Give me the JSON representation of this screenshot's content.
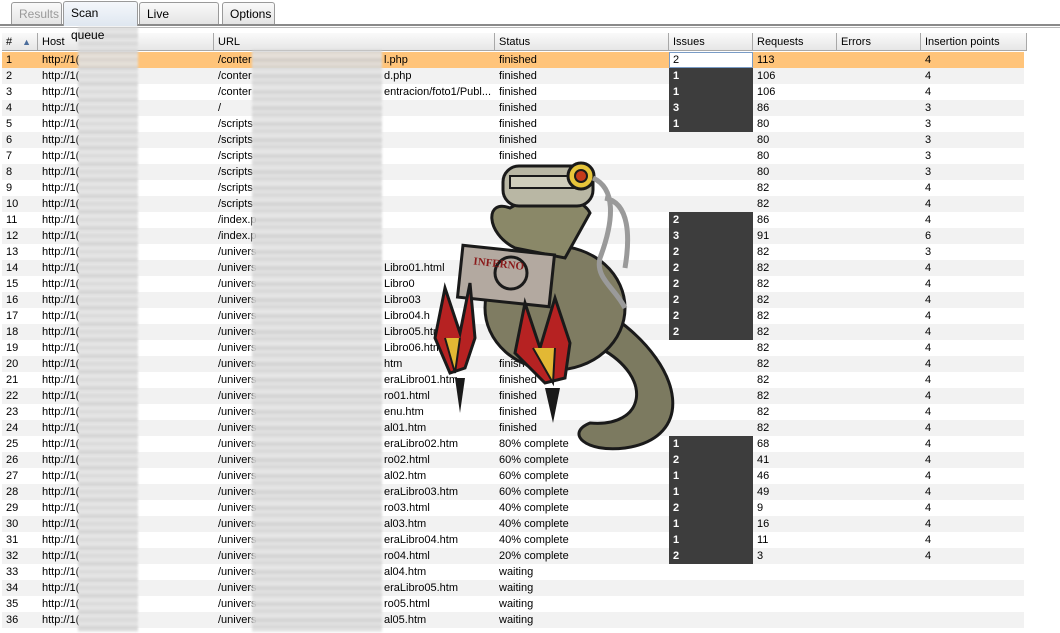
{
  "tabs": [
    {
      "label": "Results",
      "state": "disabled"
    },
    {
      "label": "Scan queue",
      "state": "active"
    },
    {
      "label": "Live scanning",
      "state": "normal"
    },
    {
      "label": "Options",
      "state": "normal"
    }
  ],
  "columns": [
    "#",
    "Host",
    "URL",
    "Status",
    "Issues",
    "Requests",
    "Errors",
    "Insertion points"
  ],
  "sort_column": "#",
  "sort_direction": "ascending",
  "rows": [
    {
      "num": "1",
      "host": "http://1(",
      "url": "/conter",
      "url_tail": "l.php",
      "status": "finished",
      "issues": "2",
      "requests": "113",
      "errors": "",
      "insertion": "4"
    },
    {
      "num": "2",
      "host": "http://1(",
      "url": "/conter",
      "url_tail": "d.php",
      "status": "finished",
      "issues": "1",
      "requests": "106",
      "errors": "",
      "insertion": "4"
    },
    {
      "num": "3",
      "host": "http://1(",
      "url": "/conter",
      "url_tail": "entracion/foto1/Publ...",
      "status": "finished",
      "issues": "1",
      "requests": "106",
      "errors": "",
      "insertion": "4"
    },
    {
      "num": "4",
      "host": "http://1(",
      "url": "/",
      "url_tail": "",
      "status": "finished",
      "issues": "3",
      "requests": "86",
      "errors": "",
      "insertion": "3"
    },
    {
      "num": "5",
      "host": "http://1(",
      "url": "/scripts",
      "url_tail": "",
      "status": "finished",
      "issues": "1",
      "requests": "80",
      "errors": "",
      "insertion": "3"
    },
    {
      "num": "6",
      "host": "http://1(",
      "url": "/scripts",
      "url_tail": "",
      "status": "finished",
      "issues": "",
      "requests": "80",
      "errors": "",
      "insertion": "3"
    },
    {
      "num": "7",
      "host": "http://1(",
      "url": "/scripts",
      "url_tail": "",
      "status": "finished",
      "issues": "",
      "requests": "80",
      "errors": "",
      "insertion": "3"
    },
    {
      "num": "8",
      "host": "http://1(",
      "url": "/scripts",
      "url_tail": "",
      "status": "",
      "issues": "",
      "requests": "80",
      "errors": "",
      "insertion": "3"
    },
    {
      "num": "9",
      "host": "http://1(",
      "url": "/scripts",
      "url_tail": "",
      "status": "",
      "issues": "",
      "requests": "82",
      "errors": "",
      "insertion": "4"
    },
    {
      "num": "10",
      "host": "http://1(",
      "url": "/scripts",
      "url_tail": "",
      "status": "",
      "issues": "",
      "requests": "82",
      "errors": "",
      "insertion": "4"
    },
    {
      "num": "11",
      "host": "http://1(",
      "url": "/index.p",
      "url_tail": "",
      "status": "",
      "issues": "2",
      "requests": "86",
      "errors": "",
      "insertion": "4"
    },
    {
      "num": "12",
      "host": "http://1(",
      "url": "/index.p",
      "url_tail": "",
      "status": "",
      "issues": "3",
      "requests": "91",
      "errors": "",
      "insertion": "6"
    },
    {
      "num": "13",
      "host": "http://1(",
      "url": "/univers",
      "url_tail": "",
      "status": "",
      "issues": "2",
      "requests": "82",
      "errors": "",
      "insertion": "3"
    },
    {
      "num": "14",
      "host": "http://1(",
      "url": "/univers",
      "url_tail": "Libro01.html",
      "status": "",
      "issues": "2",
      "requests": "82",
      "errors": "",
      "insertion": "4"
    },
    {
      "num": "15",
      "host": "http://1(",
      "url": "/univers",
      "url_tail": "Libro0",
      "status": "",
      "issues": "2",
      "requests": "82",
      "errors": "",
      "insertion": "4"
    },
    {
      "num": "16",
      "host": "http://1(",
      "url": "/univers",
      "url_tail": "Libro03",
      "status": "",
      "issues": "2",
      "requests": "82",
      "errors": "",
      "insertion": "4"
    },
    {
      "num": "17",
      "host": "http://1(",
      "url": "/univers",
      "url_tail": "Libro04.h",
      "status": "",
      "issues": "2",
      "requests": "82",
      "errors": "",
      "insertion": "4"
    },
    {
      "num": "18",
      "host": "http://1(",
      "url": "/univers",
      "url_tail": "Libro05.htm",
      "status": "",
      "issues": "2",
      "requests": "82",
      "errors": "",
      "insertion": "4"
    },
    {
      "num": "19",
      "host": "http://1(",
      "url": "/univers",
      "url_tail": "Libro06.htm",
      "status": "",
      "issues": "",
      "requests": "82",
      "errors": "",
      "insertion": "4"
    },
    {
      "num": "20",
      "host": "http://1(",
      "url": "/univers",
      "url_tail": "htm",
      "status": "finished",
      "issues": "",
      "requests": "82",
      "errors": "",
      "insertion": "4"
    },
    {
      "num": "21",
      "host": "http://1(",
      "url": "/univers",
      "url_tail": "eraLibro01.htm",
      "status": "finished",
      "issues": "",
      "requests": "82",
      "errors": "",
      "insertion": "4"
    },
    {
      "num": "22",
      "host": "http://1(",
      "url": "/univers",
      "url_tail": "ro01.html",
      "status": "finished",
      "issues": "",
      "requests": "82",
      "errors": "",
      "insertion": "4"
    },
    {
      "num": "23",
      "host": "http://1(",
      "url": "/univers",
      "url_tail": "enu.htm",
      "status": "finished",
      "issues": "",
      "requests": "82",
      "errors": "",
      "insertion": "4"
    },
    {
      "num": "24",
      "host": "http://1(",
      "url": "/univers",
      "url_tail": "al01.htm",
      "status": "finished",
      "issues": "",
      "requests": "82",
      "errors": "",
      "insertion": "4"
    },
    {
      "num": "25",
      "host": "http://1(",
      "url": "/univers",
      "url_tail": "eraLibro02.htm",
      "status": "80% complete",
      "issues": "1",
      "requests": "68",
      "errors": "",
      "insertion": "4"
    },
    {
      "num": "26",
      "host": "http://1(",
      "url": "/univers",
      "url_tail": "ro02.html",
      "status": "60% complete",
      "issues": "2",
      "requests": "41",
      "errors": "",
      "insertion": "4"
    },
    {
      "num": "27",
      "host": "http://1(",
      "url": "/univers",
      "url_tail": "al02.htm",
      "status": "60% complete",
      "issues": "1",
      "requests": "46",
      "errors": "",
      "insertion": "4"
    },
    {
      "num": "28",
      "host": "http://1(",
      "url": "/univers",
      "url_tail": "eraLibro03.htm",
      "status": "60% complete",
      "issues": "1",
      "requests": "49",
      "errors": "",
      "insertion": "4"
    },
    {
      "num": "29",
      "host": "http://1(",
      "url": "/univers",
      "url_tail": "ro03.html",
      "status": "40% complete",
      "issues": "2",
      "requests": "9",
      "errors": "",
      "insertion": "4"
    },
    {
      "num": "30",
      "host": "http://1(",
      "url": "/univers",
      "url_tail": "al03.htm",
      "status": "40% complete",
      "issues": "1",
      "requests": "16",
      "errors": "",
      "insertion": "4"
    },
    {
      "num": "31",
      "host": "http://1(",
      "url": "/univers",
      "url_tail": "eraLibro04.htm",
      "status": "40% complete",
      "issues": "1",
      "requests": "11",
      "errors": "",
      "insertion": "4"
    },
    {
      "num": "32",
      "host": "http://1(",
      "url": "/univers",
      "url_tail": "ro04.html",
      "status": "20% complete",
      "issues": "2",
      "requests": "3",
      "errors": "",
      "insertion": "4"
    },
    {
      "num": "33",
      "host": "http://1(",
      "url": "/univers",
      "url_tail": "al04.htm",
      "status": "waiting",
      "issues": "",
      "requests": "",
      "errors": "",
      "insertion": ""
    },
    {
      "num": "34",
      "host": "http://1(",
      "url": "/univers",
      "url_tail": "eraLibro05.htm",
      "status": "waiting",
      "issues": "",
      "requests": "",
      "errors": "",
      "insertion": ""
    },
    {
      "num": "35",
      "host": "http://1(",
      "url": "/univers",
      "url_tail": "ro05.html",
      "status": "waiting",
      "issues": "",
      "requests": "",
      "errors": "",
      "insertion": ""
    },
    {
      "num": "36",
      "host": "http://1(",
      "url": "/univers",
      "url_tail": "al05.htm",
      "status": "waiting",
      "issues": "",
      "requests": "",
      "errors": "",
      "insertion": ""
    }
  ],
  "selected_row": "1",
  "overlay": {
    "mascot_icon": "tentacle-mascot-icon",
    "sign_text": "INFERNO"
  },
  "colors": {
    "selected_row": "#ffc47a",
    "issues_cell": "#3d3d3d",
    "alt_row": "#f2f2f2"
  }
}
